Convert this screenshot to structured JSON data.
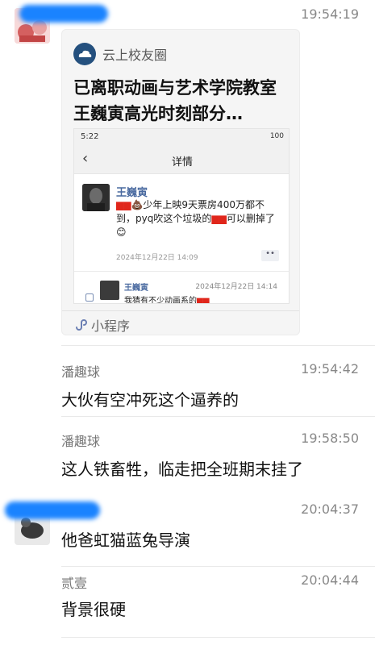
{
  "messages": [
    {
      "sender": "",
      "time": "19:54:19",
      "card": {
        "app_name": "云上校友圈",
        "title": "已离职动画与艺术学院教室王巍寅高光时刻部分…",
        "footer_label": "小程序",
        "screenshot": {
          "status_time": "5:22",
          "status_right": "100",
          "nav_title": "详情",
          "post_author": "王巍寅",
          "post_text_parts": [
            "少年上映9天票房400万都不到，pyq吹这个垃圾的",
            "可以删掉了"
          ],
          "post_date": "2024年12月22日 14:09",
          "comment_author": "王巍寅",
          "comment_date": "2024年12月22日 14:14",
          "comment_text": "我猜有不少动画系的"
        }
      }
    },
    {
      "sender": "潘趣球",
      "time": "19:54:42",
      "text": "大伙有空冲死这个逼养的"
    },
    {
      "sender": "潘趣球",
      "time": "19:58:50",
      "text": "这人铁畜牲，临走把全班期末挂了"
    },
    {
      "sender": "",
      "time": "20:04:37",
      "text": "他爸虹猫蓝兔导演"
    },
    {
      "sender": "贰壹",
      "time": "20:04:44",
      "text": "背景很硬"
    }
  ],
  "colors": {
    "name_redaction": "#1a83ff",
    "scribble_red": "#e0261b"
  },
  "icons": [
    "back-chevron-icon",
    "mini-program-icon",
    "more-dots-icon"
  ]
}
